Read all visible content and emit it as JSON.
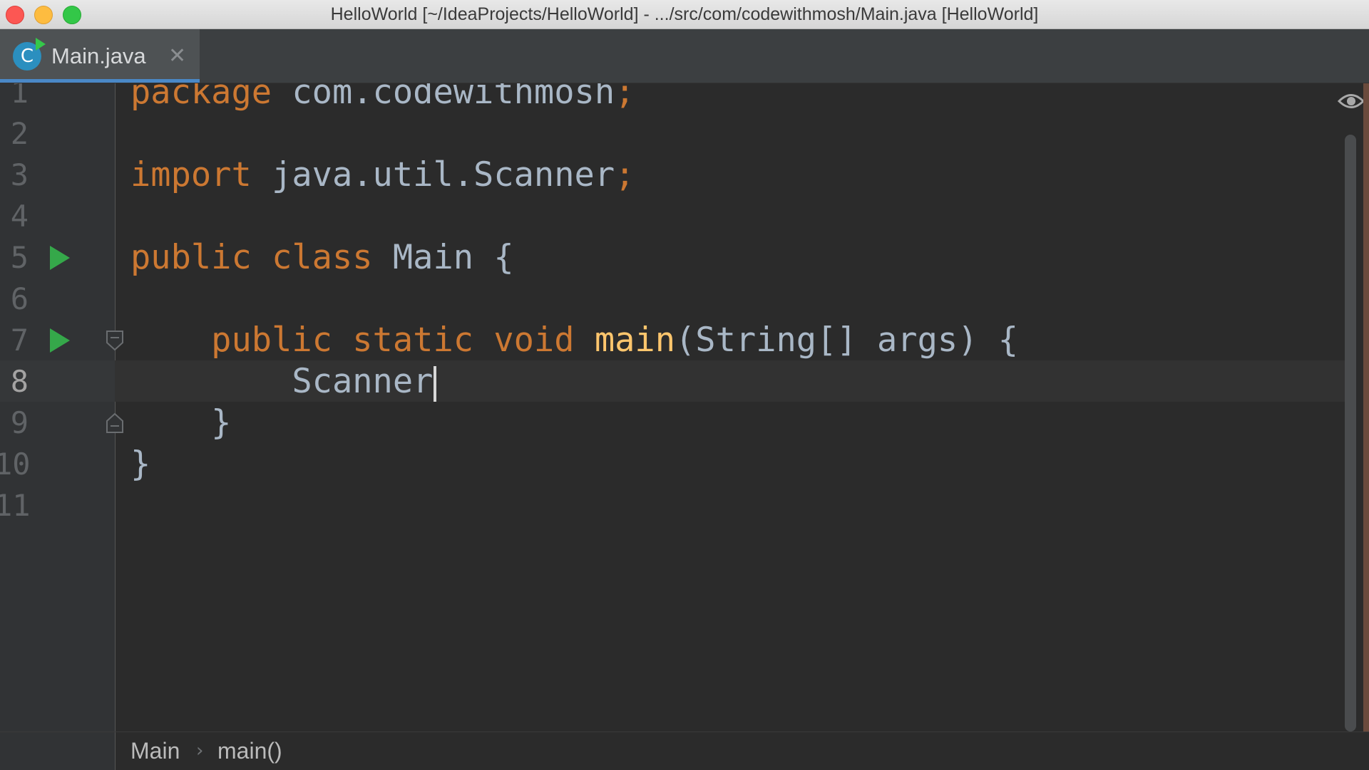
{
  "window": {
    "title": "HelloWorld [~/IdeaProjects/HelloWorld] - .../src/com/codewithmosh/Main.java [HelloWorld]"
  },
  "tabs": [
    {
      "label": "Main.java",
      "icon": "java-class-icon",
      "icon_letter": "C",
      "active": true
    }
  ],
  "editor": {
    "line_numbers": [
      "1",
      "2",
      "3",
      "4",
      "5",
      "6",
      "7",
      "8",
      "9",
      "10",
      "11"
    ],
    "current_line": 8,
    "lines": [
      {
        "tokens": [
          {
            "t": "package ",
            "k": "kw"
          },
          {
            "t": "com.codewithmosh",
            "k": "plain"
          },
          {
            "t": ";",
            "k": "kw"
          }
        ]
      },
      {
        "tokens": []
      },
      {
        "tokens": [
          {
            "t": "import ",
            "k": "kw"
          },
          {
            "t": "java.util.Scanner",
            "k": "plain"
          },
          {
            "t": ";",
            "k": "kw"
          }
        ]
      },
      {
        "tokens": []
      },
      {
        "tokens": [
          {
            "t": "public class ",
            "k": "kw"
          },
          {
            "t": "Main {",
            "k": "plain"
          }
        ]
      },
      {
        "tokens": []
      },
      {
        "tokens": [
          {
            "t": "    public static void ",
            "k": "kw"
          },
          {
            "t": "main",
            "k": "fn"
          },
          {
            "t": "(String[] args) {",
            "k": "plain"
          }
        ]
      },
      {
        "tokens": [
          {
            "t": "        Scanner",
            "k": "plain"
          }
        ],
        "caret": true
      },
      {
        "tokens": [
          {
            "t": "    }",
            "k": "plain"
          }
        ]
      },
      {
        "tokens": [
          {
            "t": "}",
            "k": "plain"
          }
        ]
      },
      {
        "tokens": []
      }
    ],
    "run_gutter_lines": [
      5,
      7
    ],
    "fold_markers": [
      7,
      9
    ]
  },
  "breadcrumbs": [
    "Main",
    "main()"
  ],
  "colors": {
    "keyword": "#cc7832",
    "function": "#ffc66d",
    "plain": "#a9b7c6",
    "run_icon": "#35a84a",
    "tab_underline": "#4a88c7"
  }
}
